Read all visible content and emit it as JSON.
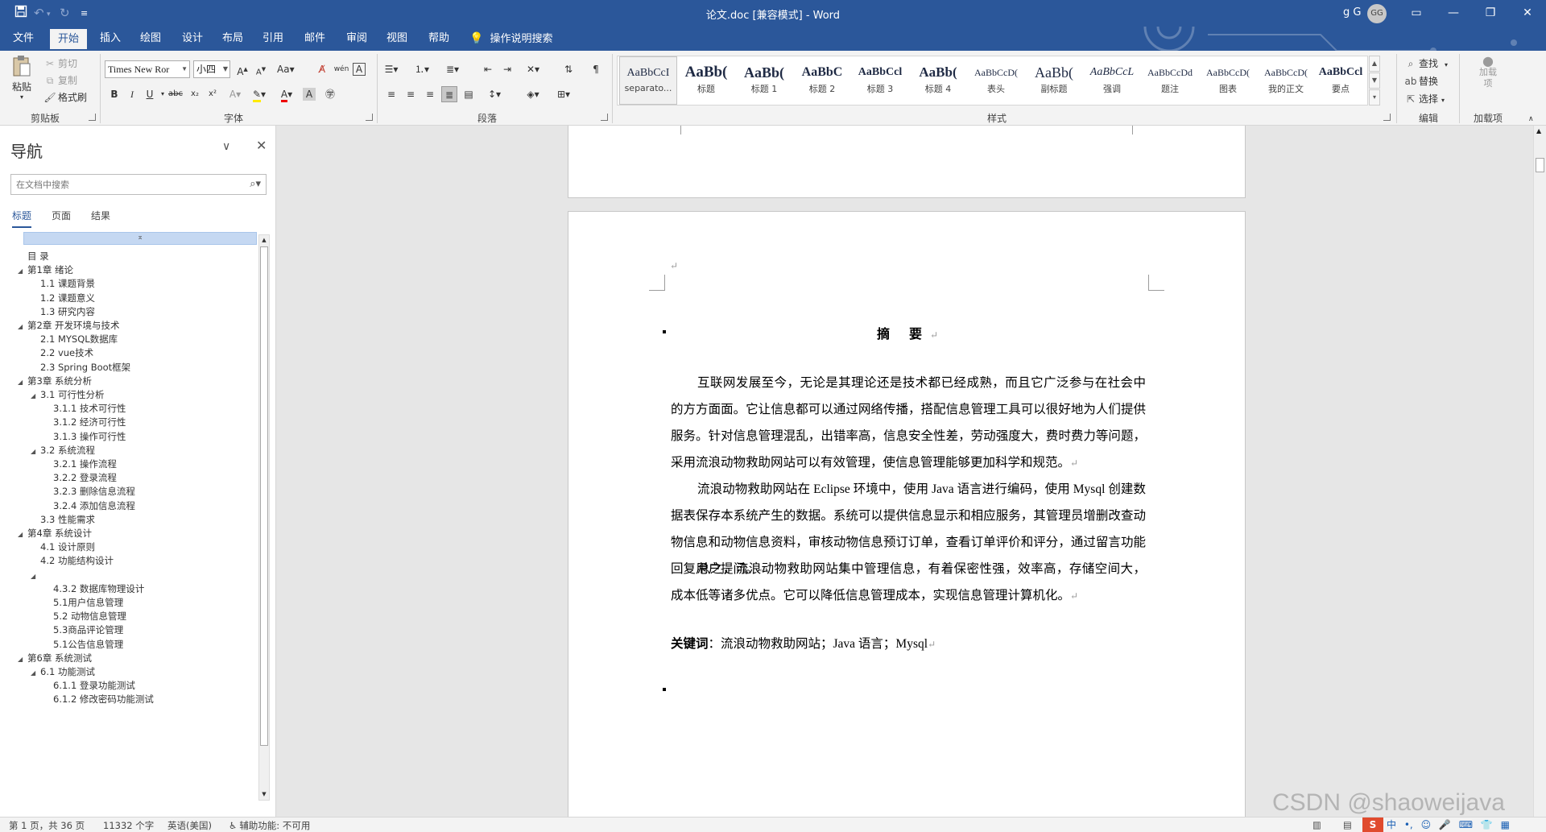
{
  "titlebar": {
    "title": "论文.doc [兼容模式] - Word",
    "user": "g G",
    "avatar": "GG",
    "save_icon": "save-icon",
    "undo_icon": "undo-icon",
    "redo_icon": "redo-icon",
    "customize_icon": "customize-quick-access-icon"
  },
  "tabs": [
    "文件",
    "开始",
    "插入",
    "绘图",
    "设计",
    "布局",
    "引用",
    "邮件",
    "审阅",
    "视图",
    "帮助"
  ],
  "active_tab": "开始",
  "tell_me": "操作说明搜索",
  "ribbon": {
    "clipboard": {
      "paste": "粘贴",
      "cut": "剪切",
      "copy": "复制",
      "format_painter": "格式刷",
      "label": "剪贴板"
    },
    "font": {
      "name": "Times New Ror",
      "size": "小四",
      "label": "字体"
    },
    "paragraph": {
      "label": "段落"
    },
    "styles": {
      "label": "样式",
      "items": [
        {
          "preview": "AaBbCcI",
          "name": "separato..."
        },
        {
          "preview": "AaBb(",
          "name": "标题"
        },
        {
          "preview": "AaBb(",
          "name": "标题 1"
        },
        {
          "preview": "AaBbC",
          "name": "标题 2"
        },
        {
          "preview": "AaBbCcl",
          "name": "标题 3"
        },
        {
          "preview": "AaBb(",
          "name": "标题 4"
        },
        {
          "preview": "AaBbCcD(",
          "name": "表头"
        },
        {
          "preview": "AaBb(",
          "name": "副标题"
        },
        {
          "preview": "AaBbCcL",
          "name": "强调"
        },
        {
          "preview": "AaBbCcDd",
          "name": "题注"
        },
        {
          "preview": "AaBbCcD(",
          "name": "图表"
        },
        {
          "preview": "AaBbCcD(",
          "name": "我的正文"
        },
        {
          "preview": "AaBbCcl",
          "name": "要点"
        }
      ]
    },
    "editing": {
      "find": "查找",
      "replace": "替换",
      "select": "选择",
      "label": "编辑"
    },
    "addins": {
      "load": "加载项",
      "label": "加载项"
    }
  },
  "nav": {
    "title": "导航",
    "search_placeholder": "在文档中搜索",
    "tabs": [
      "标题",
      "页面",
      "结果"
    ],
    "headings": [
      {
        "text": "目  录",
        "level": 0,
        "tri": ""
      },
      {
        "text": "第1章 绪论",
        "level": 0,
        "tri": "◢"
      },
      {
        "text": "1.1 课题背景",
        "level": 1,
        "tri": ""
      },
      {
        "text": "1.2 课题意义",
        "level": 1,
        "tri": ""
      },
      {
        "text": "1.3 研究内容",
        "level": 1,
        "tri": ""
      },
      {
        "text": "第2章 开发环境与技术",
        "level": 0,
        "tri": "◢"
      },
      {
        "text": "2.1 MYSQL数据库",
        "level": 1,
        "tri": ""
      },
      {
        "text": "2.2 vue技术",
        "level": 1,
        "tri": ""
      },
      {
        "text": "2.3 Spring Boot框架",
        "level": 1,
        "tri": ""
      },
      {
        "text": "第3章 系统分析",
        "level": 0,
        "tri": "◢"
      },
      {
        "text": "3.1 可行性分析",
        "level": 1,
        "tri": "◢"
      },
      {
        "text": "3.1.1 技术可行性",
        "level": 2,
        "tri": ""
      },
      {
        "text": "3.1.2 经济可行性",
        "level": 2,
        "tri": ""
      },
      {
        "text": "3.1.3 操作可行性",
        "level": 2,
        "tri": ""
      },
      {
        "text": "3.2 系统流程",
        "level": 1,
        "tri": "◢"
      },
      {
        "text": "3.2.1 操作流程",
        "level": 2,
        "tri": ""
      },
      {
        "text": "3.2.2 登录流程",
        "level": 2,
        "tri": ""
      },
      {
        "text": "3.2.3 删除信息流程",
        "level": 2,
        "tri": ""
      },
      {
        "text": "3.2.4 添加信息流程",
        "level": 2,
        "tri": ""
      },
      {
        "text": "3.3 性能需求",
        "level": 1,
        "tri": ""
      },
      {
        "text": "第4章 系统设计",
        "level": 0,
        "tri": "◢"
      },
      {
        "text": "4.1 设计原则",
        "level": 1,
        "tri": ""
      },
      {
        "text": "4.2 功能结构设计",
        "level": 1,
        "tri": ""
      },
      {
        "text": "",
        "level": 1,
        "tri": "◢"
      },
      {
        "text": "4.3.2 数据库物理设计",
        "level": 2,
        "tri": ""
      },
      {
        "text": "5.1用户信息管理",
        "level": 2,
        "tri": ""
      },
      {
        "text": "5.2 动物信息管理",
        "level": 2,
        "tri": ""
      },
      {
        "text": "5.3商品评论管理",
        "level": 2,
        "tri": ""
      },
      {
        "text": "5.1公告信息管理",
        "level": 2,
        "tri": ""
      },
      {
        "text": "第6章 系统测试",
        "level": 0,
        "tri": "◢"
      },
      {
        "text": "6.1 功能测试",
        "level": 1,
        "tri": "◢"
      },
      {
        "text": "6.1.1 登录功能测试",
        "level": 2,
        "tri": ""
      },
      {
        "text": "6.1.2 修改密码功能测试",
        "level": 2,
        "tri": ""
      }
    ]
  },
  "document": {
    "abstract_title": "摘  要",
    "paragraphs": [
      "互联网发展至今，无论是其理论还是技术都已经成熟，而且它广泛参与在社会中的方方面面。它让信息都可以通过网络传播，搭配信息管理工具可以很好地为人们提供服务。针对信息管理混乱，出错率高，信息安全性差，劳动强度大，费时费力等问题，采用流浪动物救助网站可以有效管理，使信息管理能够更加科学和规范。",
      "流浪动物救助网站在 Eclipse 环境中，使用 Java 语言进行编码，使用 Mysql 创建数据表保存本系统产生的数据。系统可以提供信息显示和相应服务，其管理员增删改查动物信息和动物信息资料，审核动物信息预订订单，查看订单评价和评分，通过留言功能回复用户提问。",
      "总之，流浪动物救助网站集中管理信息，有着保密性强，效率高，存储空间大，成本低等诸多优点。它可以降低信息管理成本，实现信息管理计算机化。"
    ],
    "keywords_label": "关键词",
    "keywords_text": "：流浪动物救助网站；Java 语言；Mysql",
    "paragraph_mark": "↵"
  },
  "statusbar": {
    "page": "第 1 页，共 36 页",
    "words": "11332 个字",
    "language": "英语(美国)",
    "accessibility": "辅助功能: 不可用",
    "ime": "中"
  },
  "watermark": "CSDN @shaoweijava"
}
